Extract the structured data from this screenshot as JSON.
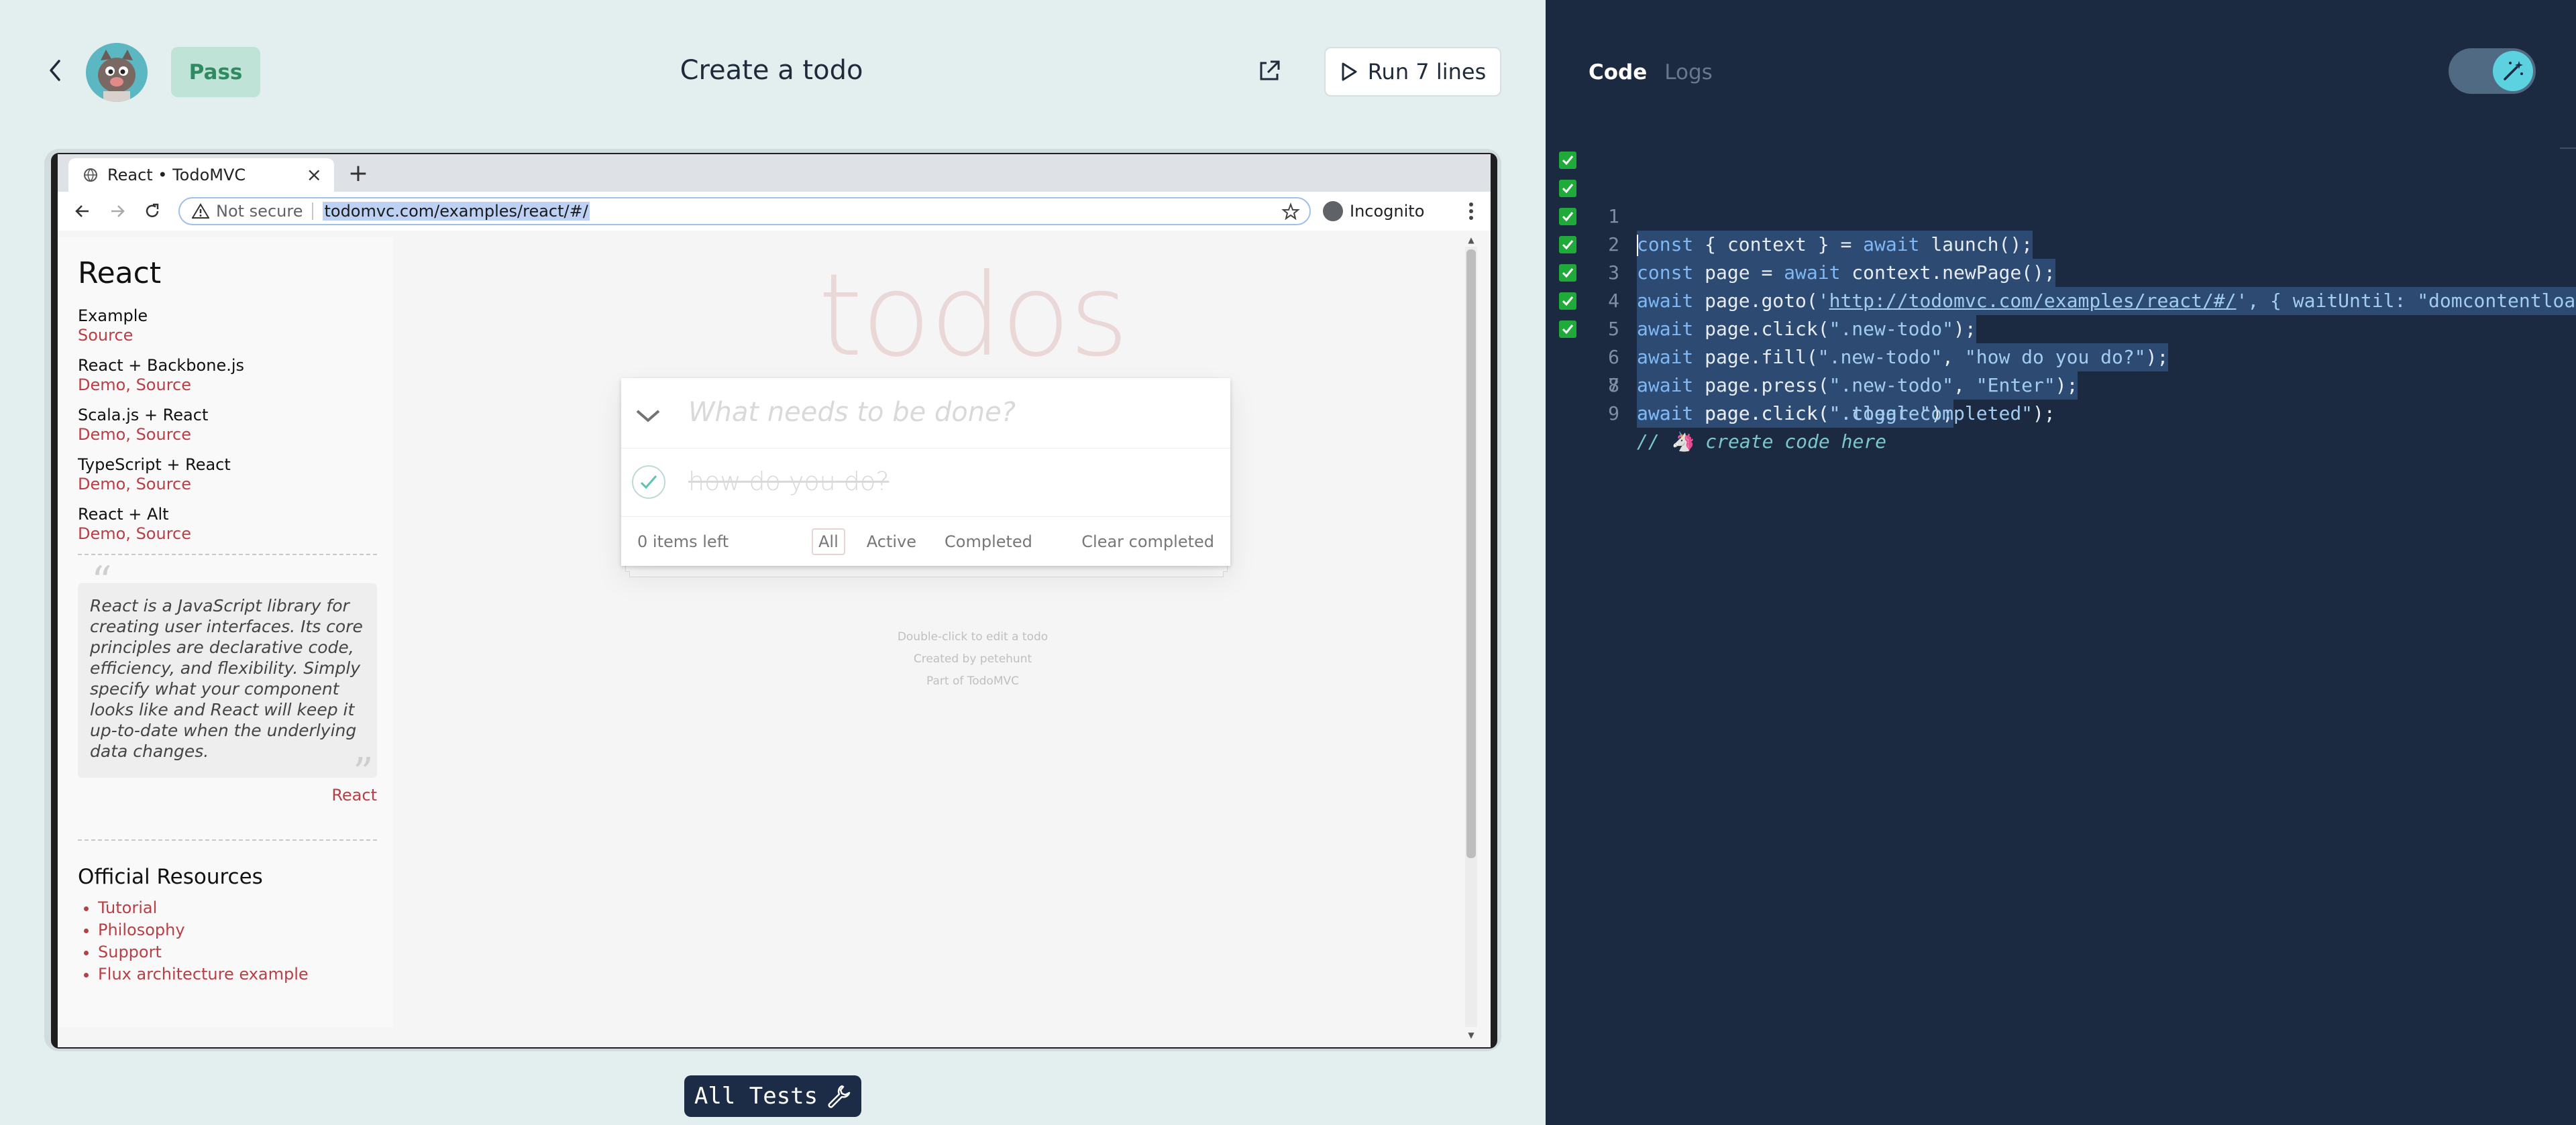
{
  "header": {
    "status_badge": "Pass",
    "test_title": "Create a todo",
    "run_button_label": "Run 7 lines"
  },
  "browser": {
    "tab_title": "React • TodoMVC",
    "security_label": "Not secure",
    "url": "todomvc.com/examples/react/#/",
    "incognito_label": "Incognito"
  },
  "sidebar": {
    "title": "React",
    "examples": [
      {
        "name": "Example",
        "links": "Source"
      },
      {
        "name": "React + Backbone.js",
        "links": "Demo, Source"
      },
      {
        "name": "Scala.js + React",
        "links": "Demo, Source"
      },
      {
        "name": "TypeScript + React",
        "links": "Demo, Source"
      },
      {
        "name": "React + Alt",
        "links": "Demo, Source"
      }
    ],
    "quote": "React is a JavaScript library for creating user interfaces. Its core principles are declarative code, efficiency, and flexibility. Simply specify what your component looks like and React will keep it up-to-date when the underlying data changes.",
    "quote_source": "React",
    "resources_title": "Official Resources",
    "resources": [
      "Tutorial",
      "Philosophy",
      "Support",
      "Flux architecture example"
    ]
  },
  "todo": {
    "heading": "todos",
    "new_placeholder": "What needs to be done?",
    "items": [
      {
        "text": "how do you do?",
        "completed": true
      }
    ],
    "count_label": "0 items left",
    "filters": [
      "All",
      "Active",
      "Completed"
    ],
    "selected_filter": "All",
    "clear_label": "Clear completed",
    "info": [
      "Double-click to edit a todo",
      "Created by petehunt",
      "Part of TodoMVC"
    ]
  },
  "all_tests_label": "All Tests",
  "editor": {
    "tabs": [
      "Code",
      "Logs"
    ],
    "active_tab": "Code",
    "lines": [
      {
        "num": "1",
        "passed": true
      },
      {
        "num": "2",
        "passed": true
      },
      {
        "num": "3",
        "passed": true
      },
      {
        "num": "4",
        "passed": true
      },
      {
        "num": "5",
        "passed": true
      },
      {
        "num": "6",
        "passed": true
      },
      {
        "num": "7",
        "passed": true
      },
      {
        "num": "8",
        "passed": false
      },
      {
        "num": "9",
        "passed": false
      }
    ],
    "code": {
      "l1_a": "const",
      "l1_b": " { context } = ",
      "l1_c": "await",
      "l1_d": " launch();",
      "l2_a": "const",
      "l2_b": " page = ",
      "l2_c": "await",
      "l2_d": " context.newPage();",
      "l3_a": "await",
      "l3_b": " page.goto(",
      "l3_c": "'",
      "l3_d": "http://todomvc.com/examples/react/#/",
      "l3_e": "', { waitUntil: ",
      "l3_f": "\"domcontentloaded\" });",
      "l4_a": "await",
      "l4_b": " page.click(",
      "l4_c": "\".new-todo\"",
      "l4_d": ");",
      "l5_a": "await",
      "l5_b": " page.fill(",
      "l5_c": "\".new-todo\"",
      "l5_d": ", ",
      "l5_e": "\"how do you do?\"",
      "l5_f": ");",
      "l6_a": "await",
      "l6_b": " page.press(",
      "l6_c": "\".new-todo\"",
      "l6_d": ", ",
      "l6_e": "\"Enter\"",
      "l6_f": ");",
      "l7_a": "await",
      "l7_b": " page.click(",
      "l7_c": "\".toggle\"",
      "l7_d": ");",
      "l8_a": "await",
      "l8_b": " page.click(",
      "l8_c": "\".clear-completed\"",
      "l8_d": ");",
      "l9": "// 🦄 create code here"
    }
  },
  "colors": {
    "left_bg": "#e3efef",
    "editor_bg": "#1b2a41",
    "pass_green": "#2e8b62",
    "todo_red": "#b83f45"
  },
  "icons": [
    "chevron-left-icon",
    "avatar-icon",
    "external-link-icon",
    "play-icon",
    "globe-icon",
    "close-icon",
    "plus-icon",
    "arrow-left-icon",
    "arrow-right-icon",
    "reload-icon",
    "warning-icon",
    "star-icon",
    "incognito-icon",
    "kebab-icon",
    "chevron-down-icon",
    "check-icon",
    "wrench-icon",
    "magic-wand-icon"
  ]
}
